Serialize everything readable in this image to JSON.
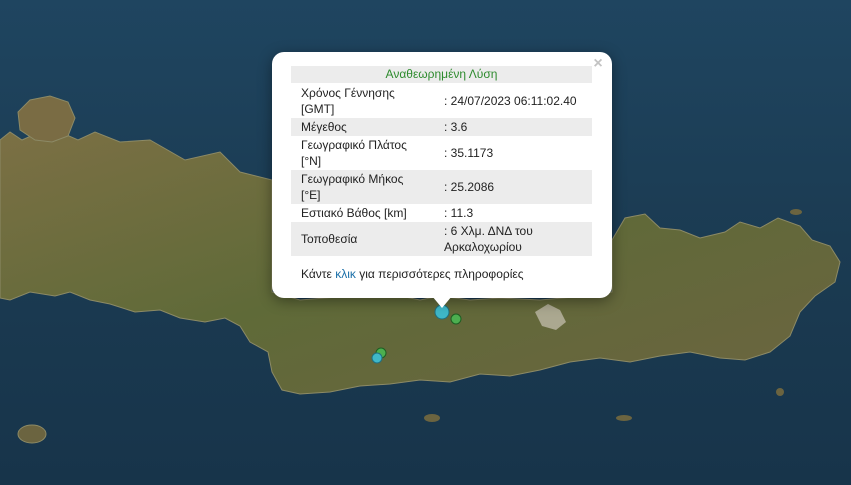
{
  "popup": {
    "title": "Αναθεωρημένη Λύση",
    "close_label": "×",
    "rows": [
      {
        "label": "Χρόνος Γέννησης [GMT]",
        "value": ": 24/07/2023 06:11:02.40"
      },
      {
        "label": "Μέγεθος",
        "value": ": 3.6"
      },
      {
        "label": "Γεωγραφικό Πλάτος [°N]",
        "value": ": 35.1173"
      },
      {
        "label": "Γεωγραφικό Μήκος [°E]",
        "value": ": 25.2086"
      },
      {
        "label": "Εστιακό Βάθος [km]",
        "value": ": 11.3"
      },
      {
        "label": "Τοποθεσία",
        "value": ": 6 Χλμ. ΔΝΔ του Αρκαλοχωρίου"
      }
    ],
    "more_prefix": "Κάντε ",
    "more_link": "κλικ",
    "more_suffix": " για περισσότερες πληροφορίες"
  },
  "colors": {
    "sea": "#1b3b52",
    "land": "#6e6b3f",
    "popup_title_text": "#2e8b2e",
    "link": "#1a6fa8",
    "marker_selected": "#3fb8c9",
    "marker_other": "#4caf50"
  }
}
